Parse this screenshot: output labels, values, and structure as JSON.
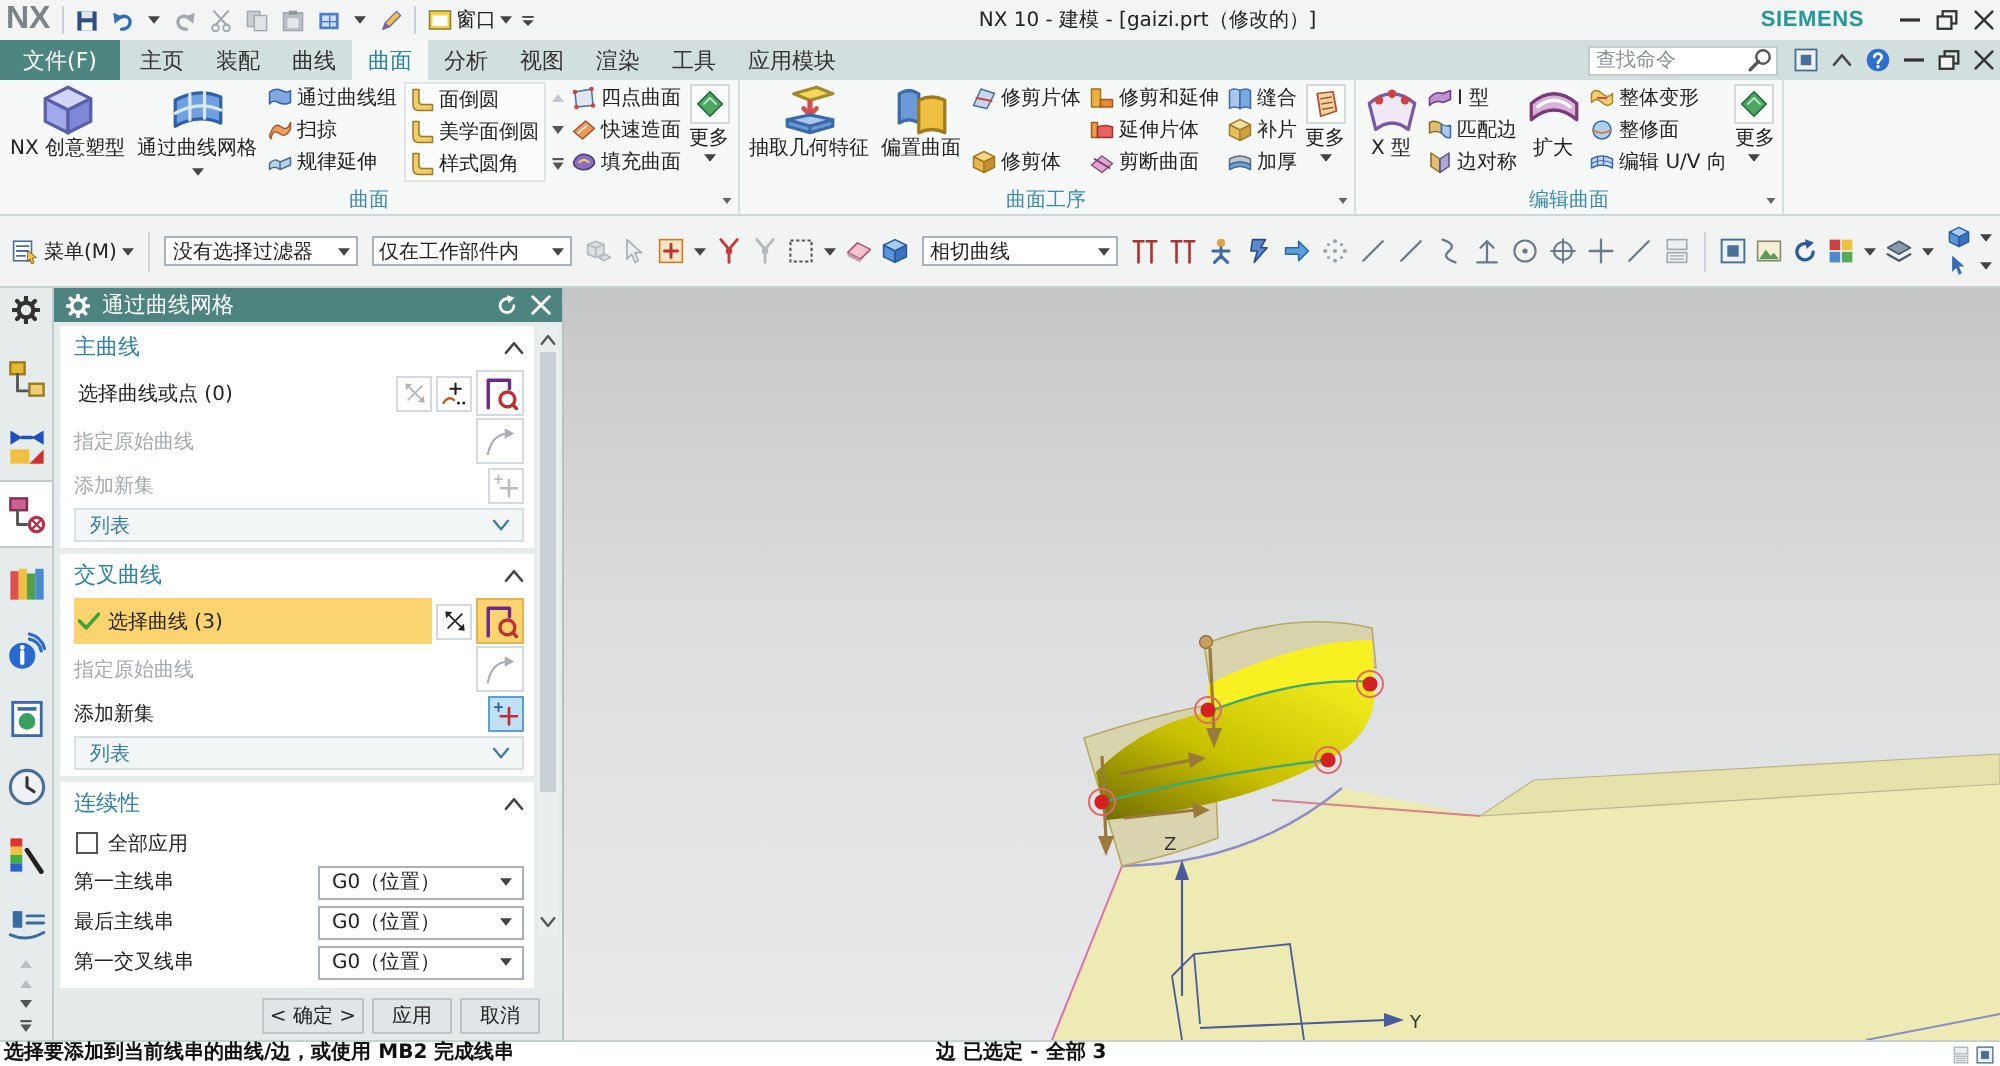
{
  "title_bar": {
    "logo": "NX",
    "window_menu": "窗口",
    "title": "NX 10 - 建模 - [gaizi.prt（修改的）]",
    "brand": "SIEMENS"
  },
  "menu_bar": {
    "file_button": "文件(F)",
    "tabs": [
      {
        "label": "主页",
        "selected": false
      },
      {
        "label": "装配",
        "selected": false
      },
      {
        "label": "曲线",
        "selected": false
      },
      {
        "label": "曲面",
        "selected": true
      },
      {
        "label": "分析",
        "selected": false
      },
      {
        "label": "视图",
        "selected": false
      },
      {
        "label": "渲染",
        "selected": false
      },
      {
        "label": "工具",
        "selected": false
      },
      {
        "label": "应用模块",
        "selected": false
      }
    ],
    "search": {
      "placeholder": "查找命令"
    }
  },
  "ribbon": {
    "groups": [
      {
        "title": "曲面",
        "items": [
          {
            "kind": "large",
            "label": "NX 创意塑型",
            "dropdown": false
          },
          {
            "kind": "large",
            "label": "通过曲线网格",
            "dropdown": true
          },
          {
            "kind": "column",
            "entries": [
              "通过曲线组",
              "扫掠",
              "规律延伸"
            ]
          },
          {
            "kind": "gallery",
            "entries": [
              "面倒圆",
              "美学面倒圆",
              "样式圆角"
            ]
          },
          {
            "kind": "column",
            "entries": [
              "四点曲面",
              "快速造面",
              "填充曲面"
            ]
          },
          {
            "kind": "more",
            "label": "更多"
          }
        ]
      },
      {
        "title": "曲面工序",
        "items": [
          {
            "kind": "large",
            "label": "抽取几何特征",
            "dropdown": false
          },
          {
            "kind": "large",
            "label": "偏置曲面",
            "dropdown": false
          },
          {
            "kind": "column",
            "entries": [
              "修剪片体",
              "修剪体"
            ]
          },
          {
            "kind": "column",
            "entries": [
              "修剪和延伸",
              "延伸片体",
              "剪断曲面"
            ]
          },
          {
            "kind": "column",
            "entries": [
              "缝合",
              "补片",
              "加厚"
            ]
          },
          {
            "kind": "more",
            "label": "更多"
          }
        ]
      },
      {
        "title": "编辑曲面",
        "items": [
          {
            "kind": "large",
            "label": "X 型",
            "dropdown": false
          },
          {
            "kind": "column",
            "entries": [
              "I 型",
              "匹配边",
              "边对称"
            ]
          },
          {
            "kind": "large",
            "label": "扩大",
            "dropdown": false
          },
          {
            "kind": "column",
            "entries": [
              "整体变形",
              "整修面",
              "编辑 U/V 向"
            ]
          },
          {
            "kind": "more",
            "label": "更多"
          }
        ]
      }
    ]
  },
  "toolbar": {
    "menu_button": "菜单(M)",
    "selection_filter": "没有选择过滤器",
    "selection_scope": "仅在工作部件内",
    "curve_rule": "相切曲线"
  },
  "resource_bar": {
    "tabs": [
      {
        "selected": false
      },
      {
        "selected": false
      },
      {
        "selected": true
      },
      {
        "selected": false
      },
      {
        "selected": false
      },
      {
        "selected": false
      },
      {
        "selected": false
      },
      {
        "selected": false
      },
      {
        "selected": false
      }
    ]
  },
  "dialog": {
    "title": "通过曲线网格",
    "sections": [
      {
        "title": "主曲线",
        "expanded": true,
        "rows": [
          {
            "kind": "select",
            "label": "选择曲线或点 (0)",
            "selected": false,
            "point_button": true
          },
          {
            "kind": "specify",
            "label": "指定原始曲线",
            "disabled": true
          },
          {
            "kind": "add_set",
            "label": "添加新集",
            "disabled": true
          },
          {
            "kind": "list",
            "label": "列表"
          }
        ]
      },
      {
        "title": "交叉曲线",
        "expanded": true,
        "rows": [
          {
            "kind": "select",
            "label": "选择曲线 (3)",
            "selected": true,
            "point_button": false
          },
          {
            "kind": "specify",
            "label": "指定原始曲线",
            "disabled": true
          },
          {
            "kind": "add_set",
            "label": "添加新集",
            "disabled": false
          },
          {
            "kind": "list",
            "label": "列表"
          }
        ]
      },
      {
        "title": "连续性",
        "expanded": true,
        "rows": [
          {
            "kind": "checkbox",
            "label": "全部应用",
            "checked": false
          },
          {
            "kind": "dropdown",
            "label": "第一主线串",
            "value": "G0（位置）"
          },
          {
            "kind": "dropdown",
            "label": "最后主线串",
            "value": "G0（位置）"
          },
          {
            "kind": "dropdown",
            "label": "第一交叉线串",
            "value": "G0（位置）"
          }
        ]
      }
    ],
    "buttons": [
      "< 确定 >",
      "应用",
      "取消"
    ]
  },
  "viewport": {
    "axes": {
      "z": "Z",
      "y": "Y"
    }
  },
  "status_bar": {
    "prompt": "选择要添加到当前线串的曲线/边，或使用 MB2 完成线串",
    "selection": "边 已选定 - 全部 3"
  }
}
